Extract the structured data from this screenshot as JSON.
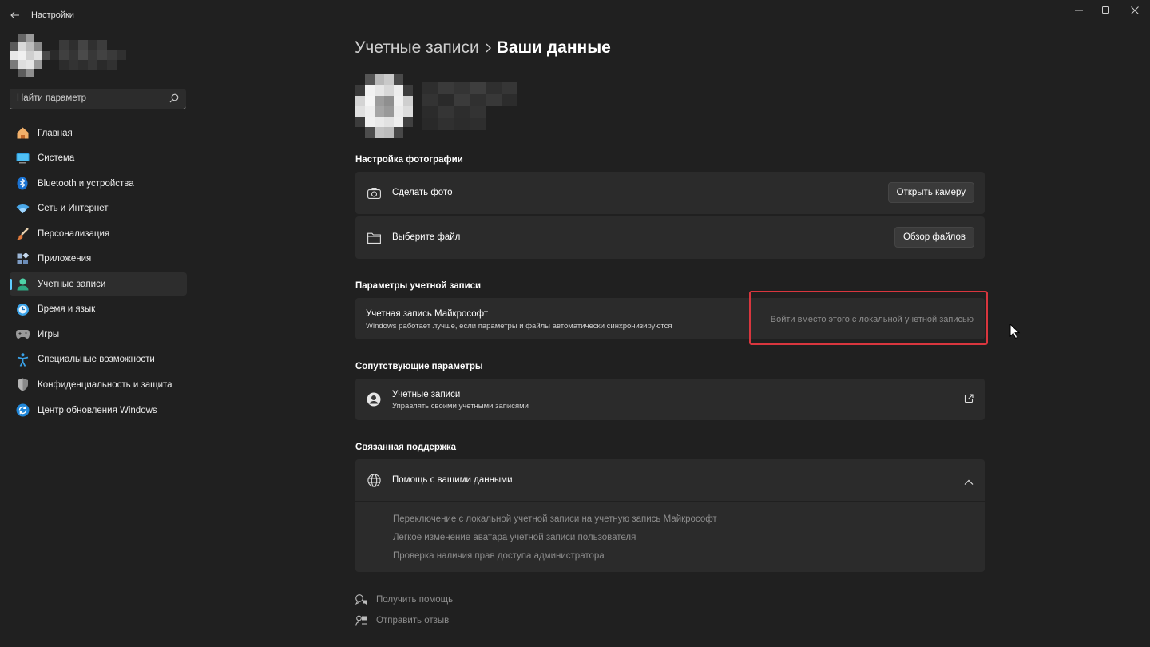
{
  "window": {
    "title": "Настройки",
    "back_icon": "back-arrow-icon",
    "controls": [
      "minimize-icon",
      "maximize-icon",
      "close-icon"
    ]
  },
  "sidebar": {
    "profile": {
      "avatar": "blurred-avatar",
      "name": "blurred-username"
    },
    "search": {
      "placeholder": "Найти параметр",
      "value": ""
    },
    "items": [
      {
        "label": "Главная",
        "icon": "home-icon",
        "active": false
      },
      {
        "label": "Система",
        "icon": "system-icon",
        "active": false
      },
      {
        "label": "Bluetooth и устройства",
        "icon": "bluetooth-icon",
        "active": false
      },
      {
        "label": "Сеть и Интернет",
        "icon": "wifi-icon",
        "active": false
      },
      {
        "label": "Персонализация",
        "icon": "brush-icon",
        "active": false
      },
      {
        "label": "Приложения",
        "icon": "apps-icon",
        "active": false
      },
      {
        "label": "Учетные записи",
        "icon": "account-icon",
        "active": true
      },
      {
        "label": "Время и язык",
        "icon": "time-language-icon",
        "active": false
      },
      {
        "label": "Игры",
        "icon": "gamepad-icon",
        "active": false
      },
      {
        "label": "Специальные возможности",
        "icon": "accessibility-icon",
        "active": false
      },
      {
        "label": "Конфиденциальность и защита",
        "icon": "shield-icon",
        "active": false
      },
      {
        "label": "Центр обновления Windows",
        "icon": "update-icon",
        "active": false
      }
    ]
  },
  "main": {
    "breadcrumb": {
      "parent": "Учетные записи",
      "current": "Ваши данные"
    },
    "photo_section": {
      "title": "Настройка фотографии",
      "take_photo": {
        "label": "Сделать фото",
        "button": "Открыть камеру",
        "icon": "camera-icon"
      },
      "choose_file": {
        "label": "Выберите файл",
        "button": "Обзор файлов",
        "icon": "folder-icon"
      }
    },
    "account_section": {
      "title": "Параметры учетной записи",
      "label": "Учетная запись Майкрософт",
      "description": "Windows работает лучше, если параметры и файлы автоматически синхронизируются",
      "link": "Войти вместо этого с локальной учетной записью"
    },
    "related_section": {
      "title": "Сопутствующие параметры",
      "label": "Учетные записи",
      "description": "Управлять своими учетными записями",
      "icon": "person-circle-icon",
      "action_icon": "open-external-icon"
    },
    "support_section": {
      "title": "Связанная поддержка",
      "label": "Помощь с вашими данными",
      "icon": "globe-icon",
      "expand_icon": "chevron-up-icon",
      "links": [
        "Переключение с локальной учетной записи на учетную запись Майкрософт",
        "Легкое изменение аватара учетной записи пользователя",
        "Проверка наличия прав доступа администратора"
      ]
    },
    "footer": {
      "get_help": "Получить помощь",
      "send_feedback": "Отправить отзыв"
    }
  },
  "colors": {
    "background": "#202020",
    "card": "#2b2b2b",
    "accent": "#60cdff",
    "highlight_border": "#d9363e"
  }
}
